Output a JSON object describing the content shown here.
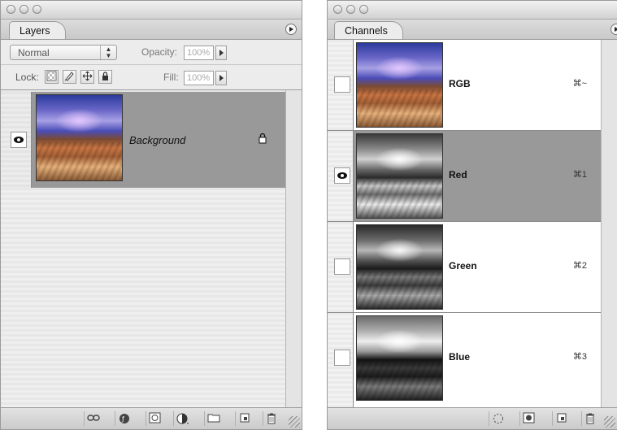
{
  "layers_panel": {
    "tab_label": "Layers",
    "blend_mode": "Normal",
    "opacity_label": "Opacity:",
    "opacity_value": "100%",
    "lock_label": "Lock:",
    "fill_label": "Fill:",
    "fill_value": "100%",
    "layers": [
      {
        "name": "Background",
        "visible": true,
        "locked": true,
        "selected": true
      }
    ]
  },
  "channels_panel": {
    "tab_label": "Channels",
    "channels": [
      {
        "name": "RGB",
        "shortcut": "⌘~",
        "visible": false,
        "selected": false
      },
      {
        "name": "Red",
        "shortcut": "⌘1",
        "visible": true,
        "selected": true
      },
      {
        "name": "Green",
        "shortcut": "⌘2",
        "visible": false,
        "selected": false
      },
      {
        "name": "Blue",
        "shortcut": "⌘3",
        "visible": false,
        "selected": false
      }
    ]
  },
  "colors": {
    "selection": "#999999",
    "panel_bg": "#ececec"
  }
}
